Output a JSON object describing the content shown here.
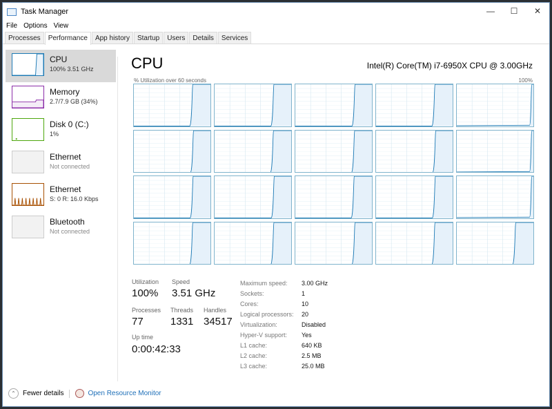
{
  "window": {
    "title": "Task Manager",
    "controls": [
      "minimize",
      "maximize",
      "close"
    ]
  },
  "menu": [
    "File",
    "Options",
    "View"
  ],
  "tabs": [
    "Processes",
    "Performance",
    "App history",
    "Startup",
    "Users",
    "Details",
    "Services"
  ],
  "active_tab": "Performance",
  "sidebar": [
    {
      "name": "CPU",
      "sub": "100% 3.51 GHz",
      "color": "#1d7ab5"
    },
    {
      "name": "Memory",
      "sub": "2.7/7.9 GB (34%)",
      "color": "#8b2ca8"
    },
    {
      "name": "Disk 0 (C:)",
      "sub": "1%",
      "color": "#4da60c"
    },
    {
      "name": "Ethernet",
      "sub": "Not connected",
      "color": "#999999"
    },
    {
      "name": "Ethernet",
      "sub": "S: 0 R: 16.0 Kbps",
      "color": "#a74f01"
    },
    {
      "name": "Bluetooth",
      "sub": "Not connected",
      "color": "#999999"
    }
  ],
  "main": {
    "title": "CPU",
    "cpu_name": "Intel(R) Core(TM) i7-6950X CPU @ 3.00GHz",
    "graph_label": "% Utilization over 60 seconds",
    "graph_max": "100%",
    "graph_color": "#1d7ab5",
    "stats": {
      "utilization_label": "Utilization",
      "utilization": "100%",
      "speed_label": "Speed",
      "speed": "3.51 GHz",
      "processes_label": "Processes",
      "processes": "77",
      "threads_label": "Threads",
      "threads": "1331",
      "handles_label": "Handles",
      "handles": "34517",
      "uptime_label": "Up time",
      "uptime": "0:00:42:33"
    },
    "specs": [
      [
        "Maximum speed:",
        "3.00 GHz"
      ],
      [
        "Sockets:",
        "1"
      ],
      [
        "Cores:",
        "10"
      ],
      [
        "Logical processors:",
        "20"
      ],
      [
        "Virtualization:",
        "Disabled"
      ],
      [
        "Hyper-V support:",
        "Yes"
      ],
      [
        "L1 cache:",
        "640 KB"
      ],
      [
        "L2 cache:",
        "2.5 MB"
      ],
      [
        "L3 cache:",
        "25.0 MB"
      ]
    ]
  },
  "footer": {
    "fewer": "Fewer details",
    "monitor": "Open Resource Monitor"
  }
}
